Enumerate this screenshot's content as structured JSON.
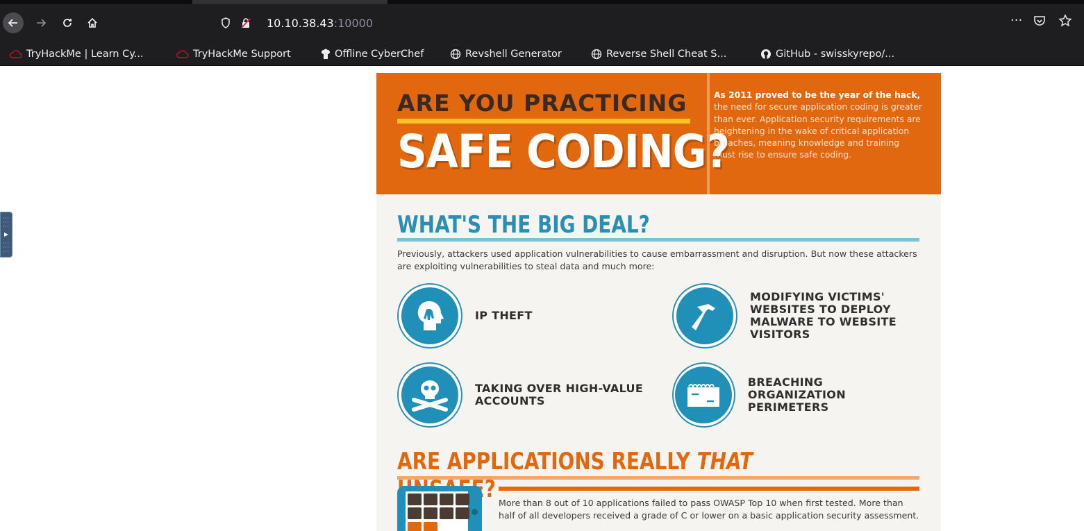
{
  "browser": {
    "url_host": "10.10.38.43",
    "url_port": ":10000"
  },
  "bookmarks": [
    {
      "label": "TryHackMe | Learn Cy...",
      "icon": "cloud-icon"
    },
    {
      "label": "TryHackMe Support",
      "icon": "cloud-icon"
    },
    {
      "label": "Offline CyberChef",
      "icon": "chef-icon"
    },
    {
      "label": "Revshell Generator",
      "icon": "globe-icon"
    },
    {
      "label": "Reverse Shell Cheat S...",
      "icon": "globe-icon"
    },
    {
      "label": "GitHub - swisskyrepo/...",
      "icon": "github-icon"
    }
  ],
  "banner": {
    "head1": "ARE YOU PRACTICING",
    "head2": "SAFE CODING?",
    "lead": "As 2011 proved to be the year of the hack,",
    "body": "the need for secure application coding is greater than ever. Application security requirements are heightening in the wake of critical application breaches, meaning knowledge and training must rise to ensure safe coding."
  },
  "big_deal": {
    "title": "WHAT'S THE BIG DEAL?",
    "intro": "Previously, attackers used application vulnerabilities to cause embarrassment and disruption. But now these attackers are exploiting vulnerabilities to steal data and much more:",
    "threats": [
      {
        "label": "IP THEFT",
        "icon": "head-hand-icon"
      },
      {
        "label": "MODIFYING VICTIMS' WEBSITES TO DEPLOY MALWARE TO WEBSITE VISITORS",
        "icon": "hammer-icon"
      },
      {
        "label": "TAKING OVER HIGH-VALUE ACCOUNTS",
        "icon": "skull-crossbones-icon"
      },
      {
        "label": "BREACHING ORGANIZATION PERIMETERS",
        "icon": "firewall-icon"
      }
    ]
  },
  "unsafe": {
    "title_pre": "ARE APPLICATIONS REALLY ",
    "title_em": "THAT",
    "title_post": " UNSAFE?",
    "stat": "More than 8 out of 10 applications failed to pass OWASP Top 10 when first tested. More than half of all developers received a grade of C or lower on a basic application security assessment."
  },
  "colors": {
    "orange": "#e2680f",
    "blue": "#2190b8",
    "yellow": "#f7c423"
  }
}
